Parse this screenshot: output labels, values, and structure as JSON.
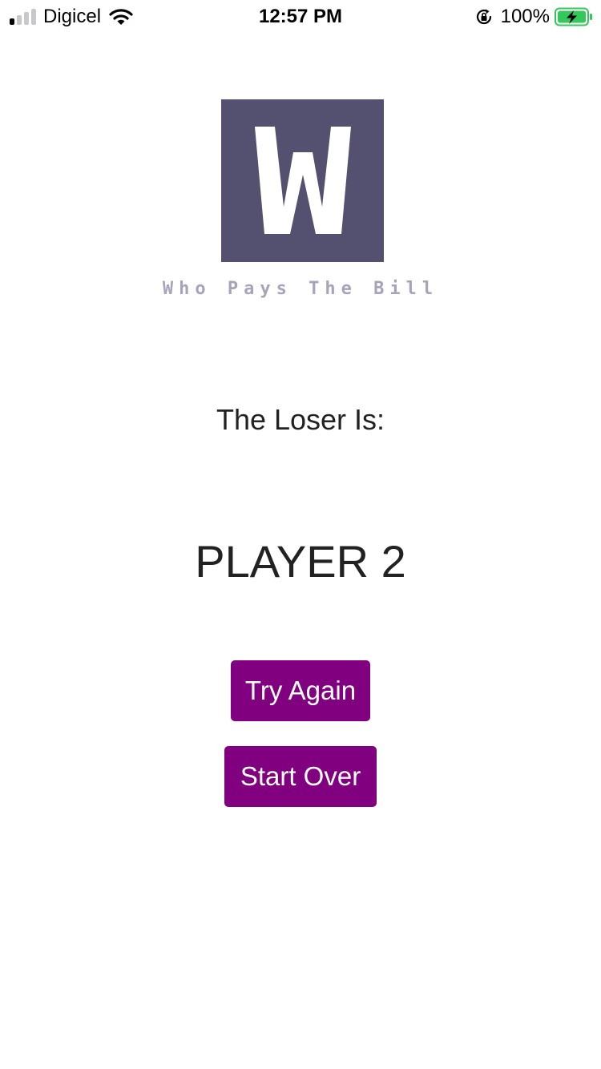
{
  "status_bar": {
    "carrier": "Digicel",
    "time": "12:57 PM",
    "battery_percent": "100%",
    "signal_bars_total": 4,
    "signal_bars_active": 1
  },
  "logo": {
    "letter": "W",
    "tagline": "Who Pays The Bill",
    "background_color": "#545170",
    "tagline_color": "#a6a4bb"
  },
  "result": {
    "heading": "The Loser Is:",
    "loser": "PLAYER 2"
  },
  "actions": {
    "try_again_label": "Try Again",
    "start_over_label": "Start Over",
    "button_color": "#800080"
  },
  "icons": {
    "signal": "cellular-signal-icon",
    "wifi": "wifi-icon",
    "orientation_lock": "orientation-lock-icon",
    "battery": "battery-charging-icon"
  }
}
